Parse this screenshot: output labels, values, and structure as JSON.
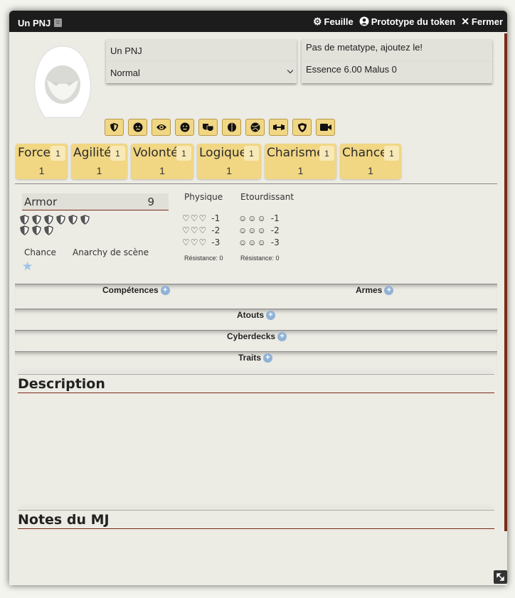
{
  "window": {
    "title": "Un PNJ",
    "controls": [
      {
        "label": "Feuille",
        "icon": "gear-icon"
      },
      {
        "label": "Prototype du token",
        "icon": "user-circle-icon"
      },
      {
        "label": "Fermer",
        "icon": "close-icon"
      }
    ]
  },
  "header": {
    "name_value": "Un PNJ",
    "type_selected": "Normal",
    "metatype_text": "Pas de metatype, ajoutez le!",
    "essence_text": "Essence 6.00 Malus 0"
  },
  "toolbar_icons": [
    "shield-icon",
    "angry-face-icon",
    "eye-icon",
    "neutral-face-icon",
    "masks-icon",
    "brain-icon",
    "cookie-icon",
    "dumbbell-icon",
    "badge-shield-icon",
    "video-icon"
  ],
  "attributes": [
    {
      "name": "Force",
      "badge": "1",
      "value": "1"
    },
    {
      "name": "Agilité",
      "badge": "1",
      "value": "1"
    },
    {
      "name": "Volonté",
      "badge": "1",
      "value": "1"
    },
    {
      "name": "Logique",
      "badge": "1",
      "value": "1"
    },
    {
      "name": "Charisme",
      "badge": "1",
      "value": "1"
    },
    {
      "name": "Chance",
      "badge": "1",
      "value": "1"
    }
  ],
  "armor": {
    "label": "Armor",
    "value": "9"
  },
  "chance_label": "Chance",
  "anarchy_label": "Anarchy de scène",
  "monitors": {
    "physical": {
      "title": "Physique",
      "rows": [
        "-1",
        "-2",
        "-3"
      ],
      "resistance": "Résistance: 0"
    },
    "stun": {
      "title": "Etourdissant",
      "rows": [
        "-1",
        "-2",
        "-3"
      ],
      "resistance": "Résistance: 0"
    }
  },
  "sections": {
    "skills": "Compétences",
    "weapons": "Armes",
    "perks": "Atouts",
    "cyberdecks": "Cyberdecks",
    "traits": "Traits"
  },
  "description_title": "Description",
  "gm_notes_title": "Notes du MJ",
  "colors": {
    "attribute_bg": "#f1d684",
    "accent": "#7a2a18",
    "plus": "#8fb2d6"
  }
}
